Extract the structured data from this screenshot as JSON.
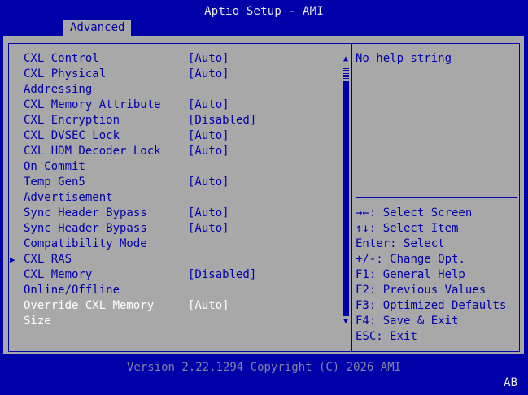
{
  "header": {
    "title": "Aptio Setup - AMI"
  },
  "tabs": [
    {
      "label": "Advanced"
    }
  ],
  "settings": [
    {
      "label": "CXL Control",
      "value": "[Auto]"
    },
    {
      "label": "CXL Physical",
      "value": "[Auto]"
    },
    {
      "label": "Addressing",
      "value": ""
    },
    {
      "label": "CXL Memory Attribute",
      "value": "[Auto]"
    },
    {
      "label": "CXL Encryption",
      "value": "[Disabled]"
    },
    {
      "label": "CXL DVSEC Lock",
      "value": "[Auto]"
    },
    {
      "label": "CXL HDM Decoder Lock",
      "value": "[Auto]"
    },
    {
      "label": "On Commit",
      "value": ""
    },
    {
      "label": "Temp Gen5",
      "value": "[Auto]"
    },
    {
      "label": "Advertisement",
      "value": ""
    },
    {
      "label": "Sync Header Bypass",
      "value": "[Auto]"
    },
    {
      "label": "Sync Header Bypass",
      "value": "[Auto]"
    },
    {
      "label": "Compatibility Mode",
      "value": ""
    },
    {
      "label": "CXL RAS",
      "value": "",
      "submenu_marker": "▶"
    },
    {
      "label": "CXL Memory",
      "value": "[Disabled]"
    },
    {
      "label": "Online/Offline",
      "value": ""
    },
    {
      "label": "Override CXL Memory",
      "value": "[Auto]",
      "selected": true
    },
    {
      "label": "Size",
      "value": "",
      "selected": true
    }
  ],
  "scrollbar": {
    "up_glyph": "▲",
    "down_glyph": "▼"
  },
  "help": {
    "text": "No help string"
  },
  "key_help": [
    {
      "key": "→←",
      "desc": ": Select Screen"
    },
    {
      "key": "↑↓",
      "desc": ": Select Item"
    },
    {
      "key": "Enter",
      "desc": ": Select"
    },
    {
      "key": "+/-",
      "desc": ": Change Opt."
    },
    {
      "key": "F1",
      "desc": ": General Help"
    },
    {
      "key": "F2",
      "desc": ": Previous Values"
    },
    {
      "key": "F3",
      "desc": ": Optimized Defaults"
    },
    {
      "key": "F4",
      "desc": ": Save & Exit"
    },
    {
      "key": "ESC",
      "desc": ": Exit"
    }
  ],
  "footer": {
    "version": "Version 2.22.1294 Copyright (C) 2026 AMI",
    "corner_code": "AB"
  },
  "colors": {
    "background": "#0000a8",
    "panel": "#a8a8a8",
    "text": "#0000a8",
    "selected": "#ffffff"
  }
}
